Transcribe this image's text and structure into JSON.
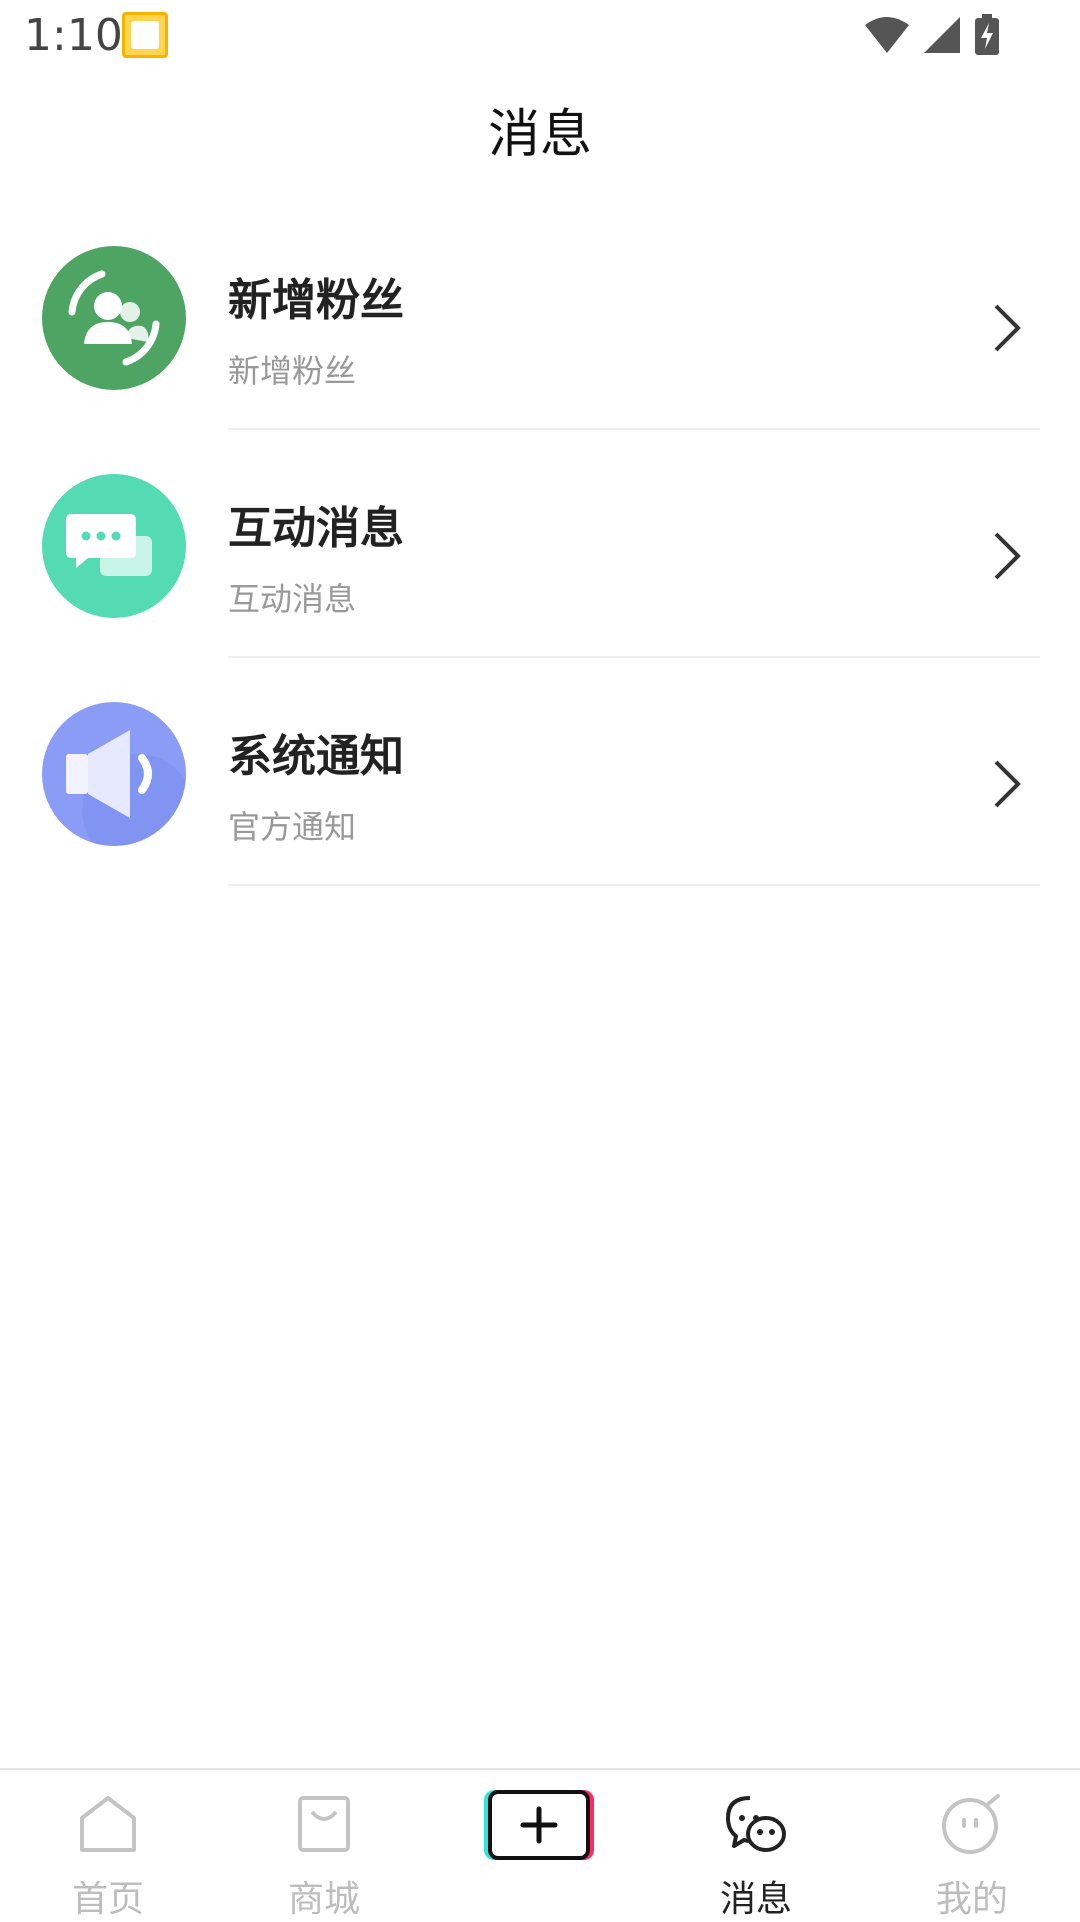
{
  "status_bar": {
    "time": "1:10",
    "icons": [
      "app-notification-icon",
      "wifi-icon",
      "signal-icon",
      "battery-charging-icon"
    ]
  },
  "header": {
    "title": "消息"
  },
  "messages": [
    {
      "title": "新增粉丝",
      "subtitle": "新增粉丝",
      "icon": "new-fans-icon",
      "color": "#4ea463"
    },
    {
      "title": "互动消息",
      "subtitle": "互动消息",
      "icon": "chat-bubbles-icon",
      "color": "#55dbb4"
    },
    {
      "title": "系统通知",
      "subtitle": "官方通知",
      "icon": "speaker-icon",
      "color": "#8b9cf6"
    }
  ],
  "bottom_nav": {
    "tabs": [
      {
        "label": "首页",
        "icon": "home-icon",
        "active": false
      },
      {
        "label": "商城",
        "icon": "shopping-bag-icon",
        "active": false
      },
      {
        "label": "",
        "icon": "plus-icon",
        "active": false
      },
      {
        "label": "消息",
        "icon": "message-icon",
        "active": true
      },
      {
        "label": "我的",
        "icon": "profile-face-icon",
        "active": false
      }
    ],
    "colors": {
      "active": "#222222",
      "inactive": "#bdbdbd"
    }
  }
}
